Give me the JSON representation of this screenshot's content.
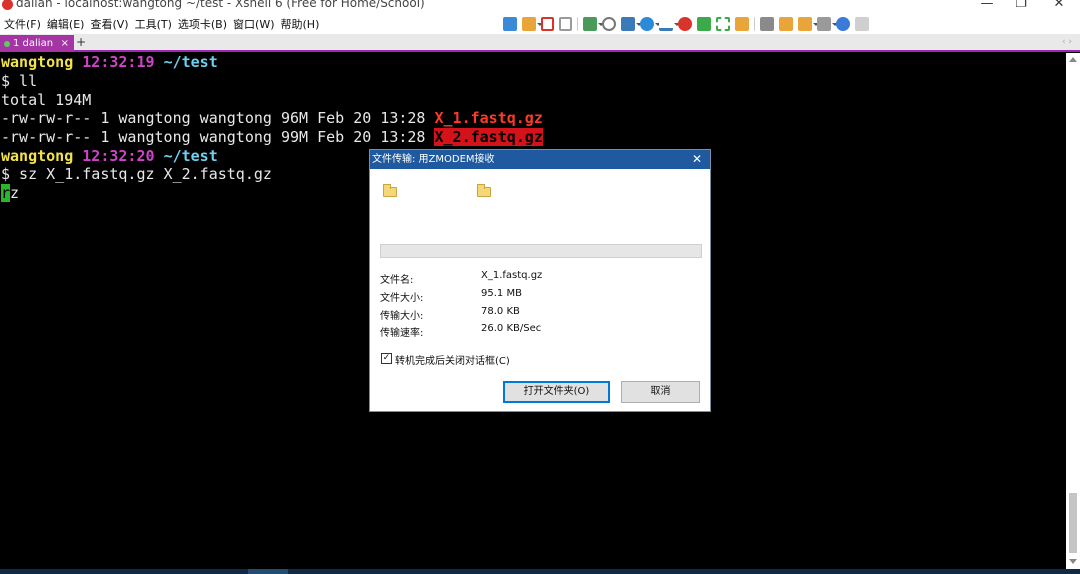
{
  "window": {
    "title": "dalian - localhost:wangtong ~/test - Xshell 6 (Free for Home/School)",
    "controls": [
      "—",
      "❐",
      "✕"
    ]
  },
  "menubar": {
    "items": [
      "文件(F)",
      "编辑(E)",
      "查看(V)",
      "工具(T)",
      "选项卡(B)",
      "窗口(W)",
      "帮助(H)"
    ]
  },
  "toolbar": {
    "icons": [
      "new-session",
      "open-folder",
      "link",
      "unlink",
      "new-window",
      "search",
      "layout",
      "globe",
      "font",
      "xshell",
      "xftp",
      "fullscreen",
      "lock",
      "keyboard",
      "script",
      "compose",
      "transfer",
      "help",
      "chat"
    ],
    "colors": {
      "blue": "#3a8ad8",
      "orange": "#e9a43a",
      "green": "#3aaa4a",
      "red": "#d9332b",
      "gray": "#8a8a8a"
    }
  },
  "tabs": {
    "items": [
      {
        "label": "1 dalian",
        "close": "×"
      }
    ],
    "new_tab": "+",
    "nav": "‹ ›"
  },
  "terminal": {
    "prompt1": {
      "user": "wangtong",
      "time": "12:32:19",
      "path": "~/test"
    },
    "cmd1": "$ ll",
    "total": "total 194M",
    "files": [
      {
        "perm": "-rw-rw-r-- 1 wangtong wangtong 96M Feb 20 13:28 ",
        "name": "X_1.fastq.gz"
      },
      {
        "perm": "-rw-rw-r-- 1 wangtong wangtong 99M Feb 20 13:28 ",
        "name": "X_2.fastq.gz"
      }
    ],
    "prompt2": {
      "user": "wangtong",
      "time": "12:32:20",
      "path": "~/test"
    },
    "cmd2": "$ sz X_1.fastq.gz X_2.fastq.gz",
    "rz_first": "r",
    "rz_rest": "z"
  },
  "dialog": {
    "title": "文件传输: 用ZMODEM接收",
    "close": "✕",
    "fields": [
      {
        "label": "文件名:",
        "value": "X_1.fastq.gz"
      },
      {
        "label": "文件大小:",
        "value": "95.1 MB"
      },
      {
        "label": "传输大小:",
        "value": "78.0 KB"
      },
      {
        "label": "传输速率:",
        "value": "26.0 KB/Sec"
      }
    ],
    "progress": 0,
    "checkbox": {
      "label": "转机完成后关闭对话框(C)",
      "checked": true,
      "mark": "✓"
    },
    "open_folder_button": "打开文件夹(O)",
    "cancel_button": "取消"
  }
}
